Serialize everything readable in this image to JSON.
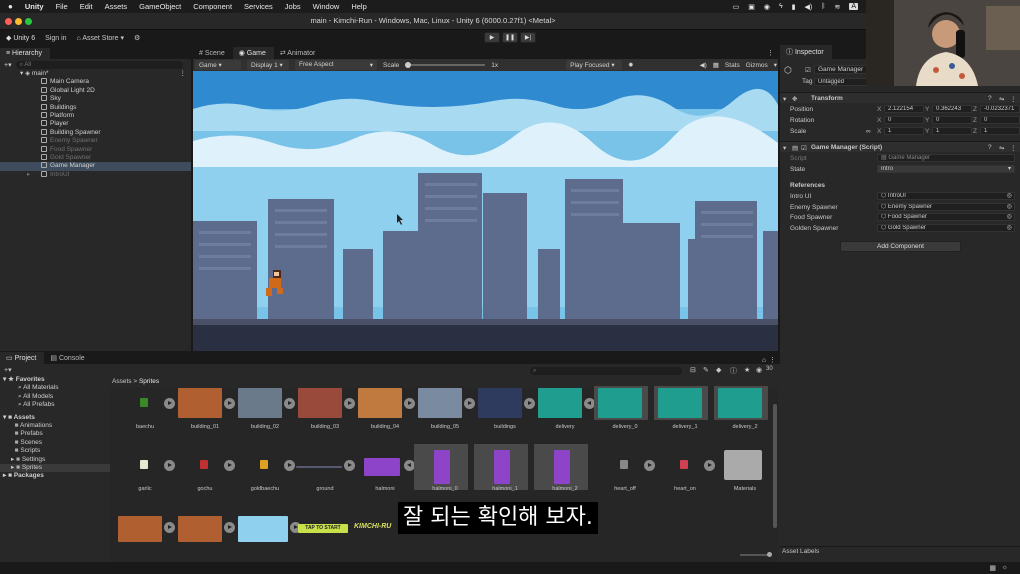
{
  "menubar": {
    "apple": "",
    "app_name": "Unity",
    "items": [
      "File",
      "Edit",
      "Assets",
      "GameObject",
      "Component",
      "Services",
      "Jobs",
      "Window",
      "Help"
    ]
  },
  "window": {
    "title": "main - Kimchi-Run - Windows, Mac, Linux - Unity 6 (6000.0.27f1) <Metal>"
  },
  "toolbar": {
    "account": "Unity 6",
    "sign_in": "Sign in",
    "asset_store": "Asset Store"
  },
  "hierarchy": {
    "tab": "Hierarchy",
    "search_placeholder": "All",
    "scene": "main*",
    "items": [
      {
        "label": "Main Camera",
        "dim": false
      },
      {
        "label": "Global Light 2D",
        "dim": false
      },
      {
        "label": "Sky",
        "dim": false
      },
      {
        "label": "Buildings",
        "dim": false
      },
      {
        "label": "Platform",
        "dim": false
      },
      {
        "label": "Player",
        "dim": false
      },
      {
        "label": "Building Spawner",
        "dim": false
      },
      {
        "label": "Enemy Spawner",
        "dim": true
      },
      {
        "label": "Food Spawner",
        "dim": true
      },
      {
        "label": "Gold Spawner",
        "dim": true
      },
      {
        "label": "Game Manager",
        "dim": false,
        "selected": true
      },
      {
        "label": "IntroUI",
        "dim": true
      }
    ]
  },
  "center_tabs": [
    "Scene",
    "Game",
    "Animator"
  ],
  "gamebar": {
    "mode": "Game",
    "display": "Display 1",
    "aspect": "Free Aspect",
    "scale_label": "Scale",
    "scale_value": "1x",
    "play_focused": "Play Focused",
    "stats": "Stats",
    "gizmos": "Gizmos"
  },
  "inspector": {
    "tab": "Inspector",
    "object_name": "Game Manager",
    "tag_label": "Tag",
    "tag_value": "Untagged",
    "transform": {
      "title": "Transform",
      "position_label": "Position",
      "rotation_label": "Rotation",
      "scale_label": "Scale",
      "position": [
        "2.122154",
        "0.362243",
        "-0.0232371"
      ],
      "rotation": [
        "0",
        "0",
        "0"
      ],
      "scale": [
        "1",
        "1",
        "1"
      ],
      "axes": [
        "X",
        "Y",
        "Z"
      ]
    },
    "script_component": {
      "title": "Game Manager (Script)",
      "script_label": "Script",
      "script_value": "Game Manager",
      "state_label": "State",
      "state_value": "Intro",
      "references_label": "References",
      "refs": [
        {
          "label": "Intro UI",
          "value": "IntroUI"
        },
        {
          "label": "Enemy Spawner",
          "value": "Enemy Spawner"
        },
        {
          "label": "Food Spawner",
          "value": "Food Spawner"
        },
        {
          "label": "Golden Spawner",
          "value": "Gold Spawner"
        }
      ]
    },
    "add_component": "Add Component",
    "asset_labels": "Asset Labels"
  },
  "project": {
    "tabs": [
      "Project",
      "Console"
    ],
    "favorites": "Favorites",
    "fav_items": [
      "All Materials",
      "All Models",
      "All Prefabs"
    ],
    "assets": "Assets",
    "asset_folders": [
      "Animations",
      "Prefabs",
      "Scenes",
      "Scripts",
      "Settings",
      "Sprites"
    ],
    "packages": "Packages",
    "breadcrumb": [
      "Assets",
      "Sprites"
    ],
    "count": "30",
    "row1": [
      "baechu",
      "building_01",
      "building_02",
      "building_03",
      "building_04",
      "building_05",
      "buildings",
      "delivery",
      "delivery_0",
      "delivery_1",
      "delivery_2"
    ],
    "row2": [
      "garlic",
      "gochu",
      "goldbaechu",
      "ground",
      "halmoni",
      "halmoni_0",
      "halmoni_1",
      "halmoni_2",
      "heart_off",
      "heart_on",
      "Materials"
    ],
    "tap_to_start": "TAP TO START",
    "kimchi_run": "KIMCHI-RU"
  },
  "subtitle": "잘 되는 확인해 보자.",
  "colors": {
    "accent_blue": "#3e4c5e",
    "sky": "#7cc4ea",
    "building": "#5d6b8d",
    "ground": "#2e3347",
    "halmoni_purple": "#8e44c8",
    "delivery_teal": "#1f9e8f"
  }
}
